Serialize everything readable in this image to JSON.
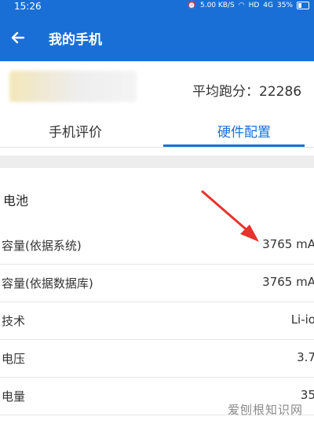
{
  "status_bar": {
    "time": "15:26",
    "speed": "5.00\nKB/S",
    "network": "HD",
    "signal": "4G",
    "battery": "35%"
  },
  "app_bar": {
    "title": "我的手机"
  },
  "device": {
    "score_text": "平均跑分：22286"
  },
  "tabs": [
    {
      "label": "手机评价",
      "active": false
    },
    {
      "label": "硬件配置",
      "active": true
    }
  ],
  "section": {
    "title": "电池"
  },
  "rows": [
    {
      "label": "容量(依据系统)",
      "value": "3765 mA"
    },
    {
      "label": "容量(依据数据库)",
      "value": "3765 mA"
    },
    {
      "label": "技术",
      "value": "Li-io"
    },
    {
      "label": "电压",
      "value": "3.7"
    },
    {
      "label": "电量",
      "value": "35"
    }
  ],
  "watermark": "爱刨根知识网",
  "colors": {
    "primary": "#1a6fd6",
    "arrow": "#e8322c"
  }
}
